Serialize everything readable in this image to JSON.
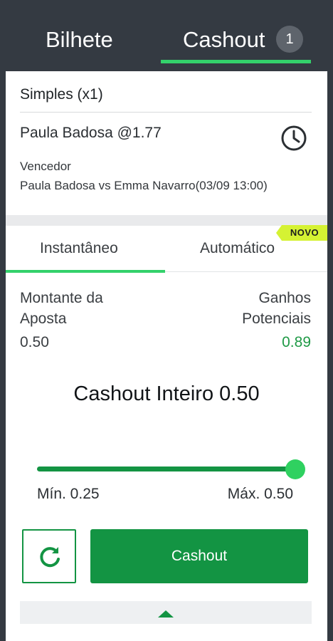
{
  "header": {
    "tabs": [
      {
        "label": "Bilhete"
      },
      {
        "label": "Cashout",
        "badge": "1"
      }
    ],
    "active_tab": "Cashout"
  },
  "bet": {
    "type": "Simples (x1)",
    "selection": "Paula Badosa @1.77",
    "market": "Vencedor",
    "event": "Paula Badosa vs Emma Navarro(03/09 13:00)",
    "status_icon": "clock-icon"
  },
  "modes": {
    "tabs": [
      {
        "label": "Instantâneo"
      },
      {
        "label": "Automático",
        "badge": "NOVO"
      }
    ],
    "active": "Instantâneo"
  },
  "amounts": {
    "stake_label": "Montante da Aposta",
    "stake_value": "0.50",
    "winnings_label": "Ganhos Potenciais",
    "winnings_value": "0.89"
  },
  "cashout": {
    "title": "Cashout Inteiro",
    "amount": "0.50",
    "slider_min": "Mín. 0.25",
    "slider_max": "Máx. 0.50",
    "slider_level": 1.0,
    "button_label": "Cashout",
    "refresh_icon": "refresh-icon",
    "expand_icon": "caret-up-icon"
  },
  "colors": {
    "background": "#343a42",
    "accent": "#33d16b",
    "primary_button": "#139443",
    "winnings": "#1f9a46",
    "new_badge": "#d5f233"
  }
}
